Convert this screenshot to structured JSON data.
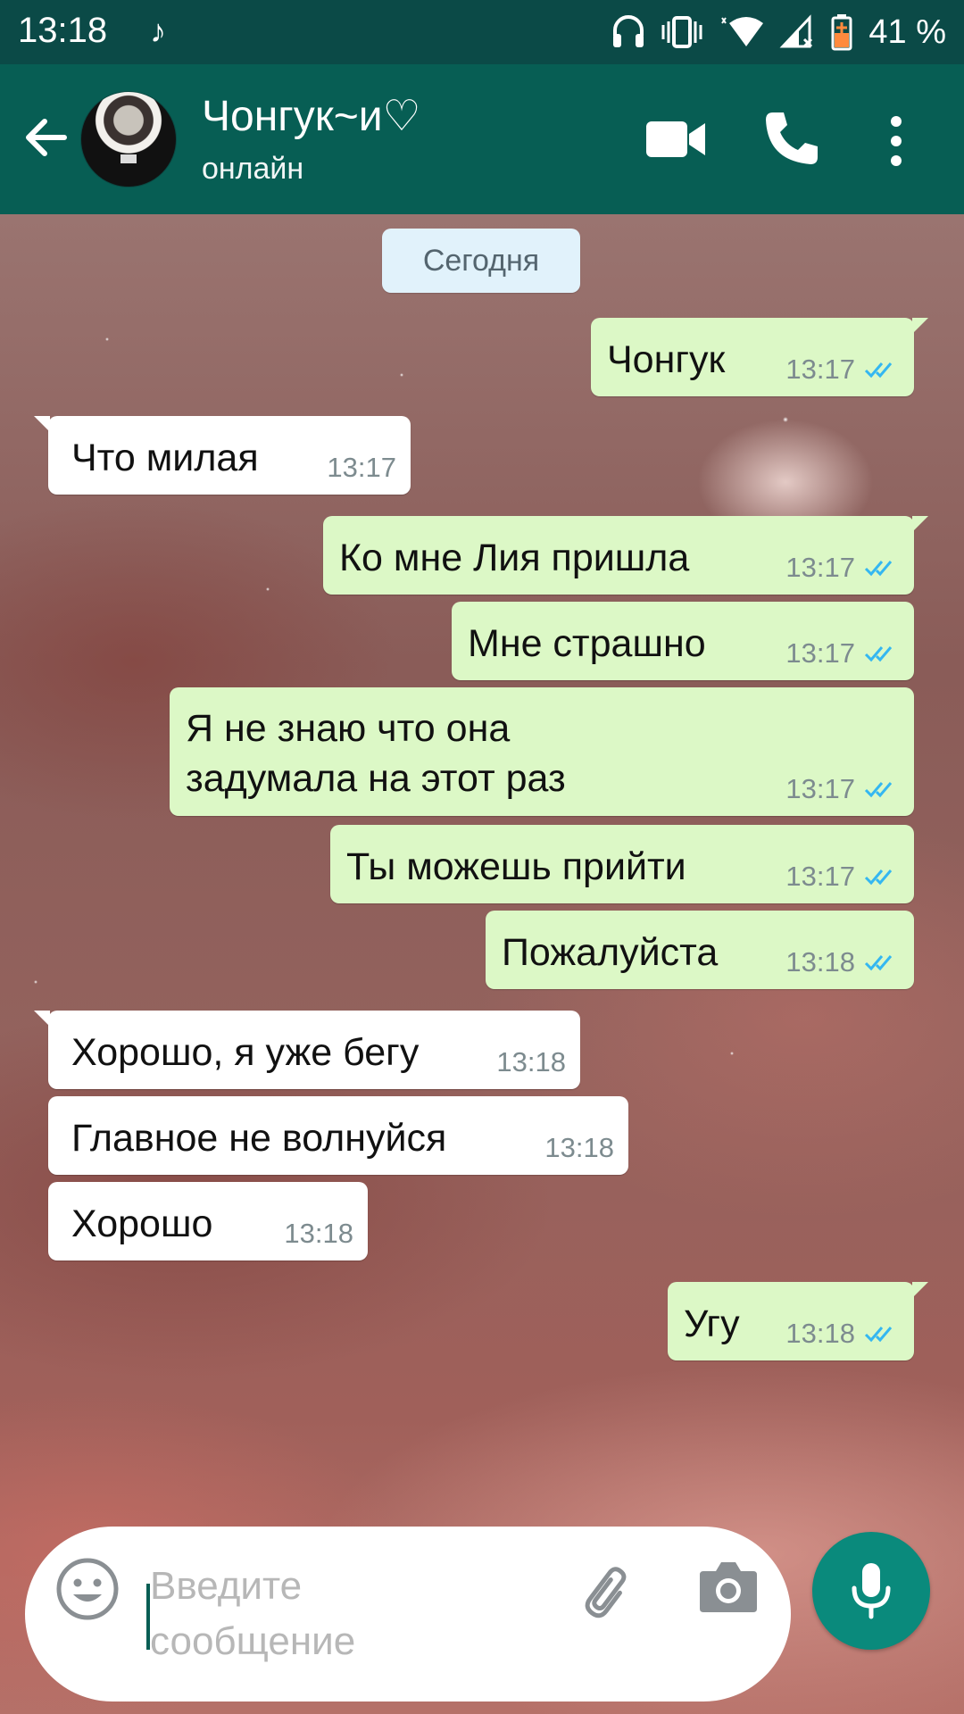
{
  "status_bar": {
    "time": "13:18",
    "battery_percent": "41 %",
    "icons": [
      "music-note-icon",
      "headphones-icon",
      "vibrate-icon",
      "wifi-icon",
      "signal-icon",
      "battery-icon"
    ]
  },
  "header": {
    "contact_name": "Чонгук~и♡",
    "status": "онлайн",
    "actions": [
      "back-arrow-icon",
      "video-call-icon",
      "phone-icon",
      "more-vert-icon"
    ]
  },
  "chat": {
    "date_label": "Сегодня",
    "messages": [
      {
        "dir": "out",
        "text": "Чонгук",
        "time": "13:17",
        "read": true
      },
      {
        "dir": "in",
        "text": "Что милая",
        "time": "13:17"
      },
      {
        "dir": "out",
        "text": "Ко мне Лия пришла",
        "time": "13:17",
        "read": true
      },
      {
        "dir": "out",
        "text": "Мне страшно",
        "time": "13:17",
        "read": true
      },
      {
        "dir": "out",
        "text_line1": "Я не знаю что она",
        "text_line2": "задумала на этот раз",
        "time": "13:17",
        "read": true
      },
      {
        "dir": "out",
        "text": "Ты можешь прийти",
        "time": "13:17",
        "read": true
      },
      {
        "dir": "out",
        "text": "Пожалуйста",
        "time": "13:18",
        "read": true
      },
      {
        "dir": "in",
        "text": "Хорошо, я уже бегу",
        "time": "13:18"
      },
      {
        "dir": "in",
        "text": "Главное не волнуйся",
        "time": "13:18"
      },
      {
        "dir": "in",
        "text": "Хорошо",
        "time": "13:18"
      },
      {
        "dir": "out",
        "text": "Угу",
        "time": "13:18",
        "read": true
      }
    ]
  },
  "composer": {
    "placeholder_line1": "Введите",
    "placeholder_line2": "сообщение"
  },
  "colors": {
    "header": "#075e54",
    "status_bar": "#0b4a47",
    "outgoing_bubble": "#dcf8c6",
    "incoming_bubble": "#ffffff",
    "read_check": "#34b7f1",
    "mic_button": "#0a8a7c"
  }
}
